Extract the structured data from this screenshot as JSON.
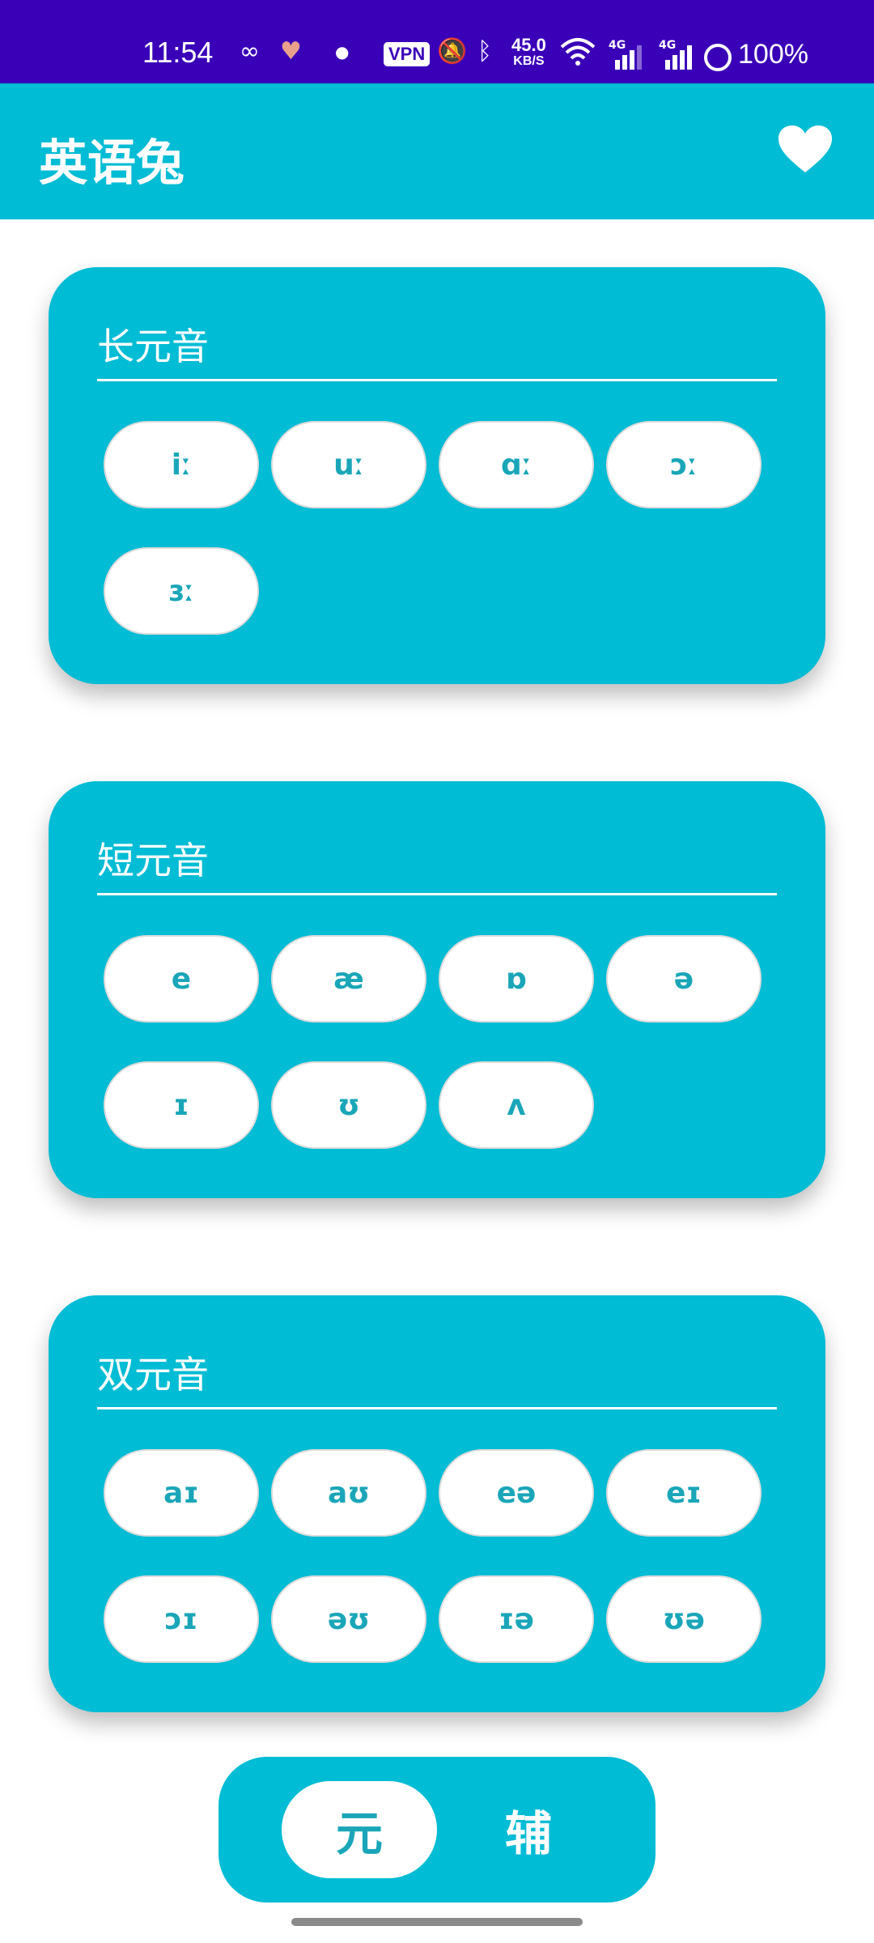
{
  "status_bar": {
    "time": "11:54",
    "vpn": "VPN",
    "speed_value": "45.0",
    "speed_unit": "KB/S",
    "net_label_1": "4G",
    "net_label_2": "4G",
    "battery": "100%"
  },
  "app_bar": {
    "title": "英语兔",
    "favorite_icon": "heart-icon"
  },
  "sections": [
    {
      "title": "长元音",
      "symbols": [
        "iː",
        "uː",
        "ɑː",
        "ɔː",
        "ɜː"
      ]
    },
    {
      "title": "短元音",
      "symbols": [
        "e",
        "æ",
        "ɒ",
        "ə",
        "ɪ",
        "ʊ",
        "ʌ"
      ]
    },
    {
      "title": "双元音",
      "symbols": [
        "aɪ",
        "aʊ",
        "eə",
        "eɪ",
        "ɔɪ",
        "əʊ",
        "ɪə",
        "ʊə"
      ]
    }
  ],
  "bottom_toggle": {
    "vowel_label": "元",
    "consonant_label": "辅",
    "selected": "vowel"
  },
  "colors": {
    "status_bar": "#3a00b8",
    "accent": "#00bcd4",
    "pill_text": "#1aa6b8"
  }
}
